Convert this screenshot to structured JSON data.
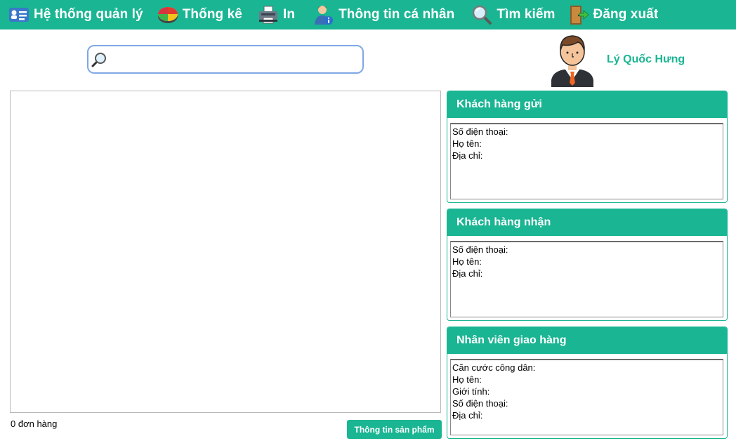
{
  "menu": [
    {
      "name": "management-menu",
      "icon": "management-icon",
      "label": "Hệ thống quản lý"
    },
    {
      "name": "statistics-menu",
      "icon": "pie-chart-icon",
      "label": "Thống kê"
    },
    {
      "name": "print-menu",
      "icon": "printer-icon",
      "label": "In"
    },
    {
      "name": "profile-menu",
      "icon": "user-info-icon",
      "label": "Thông tin cá nhân"
    },
    {
      "name": "search-menu",
      "icon": "magnifier-icon",
      "label": "Tìm kiếm"
    },
    {
      "name": "logout-menu",
      "icon": "exit-door-icon",
      "label": "Đăng xuất"
    }
  ],
  "search": {
    "value": "",
    "placeholder": ""
  },
  "user": {
    "name": "Lý Quốc Hưng"
  },
  "orders": {
    "count_label": "0 đơn hàng"
  },
  "product_button": {
    "label": "Thông tin sản phẩm"
  },
  "sender": {
    "title": "Khách hàng gửi",
    "fields": [
      "Số điện thoại:",
      "Họ tên:",
      "Địa chỉ:"
    ]
  },
  "receiver": {
    "title": "Khách hàng nhận",
    "fields": [
      "Số điện thoại:",
      "Họ tên:",
      "Địa chỉ:"
    ]
  },
  "shipper": {
    "title": "Nhân viên giao hàng",
    "fields": [
      "Căn cước công dân:",
      "Họ tên:",
      "Giới tính:",
      "Số điện thoại:",
      "Địa chỉ:"
    ]
  },
  "colors": {
    "accent": "#1ab593",
    "search_border": "#7ea8e4"
  }
}
